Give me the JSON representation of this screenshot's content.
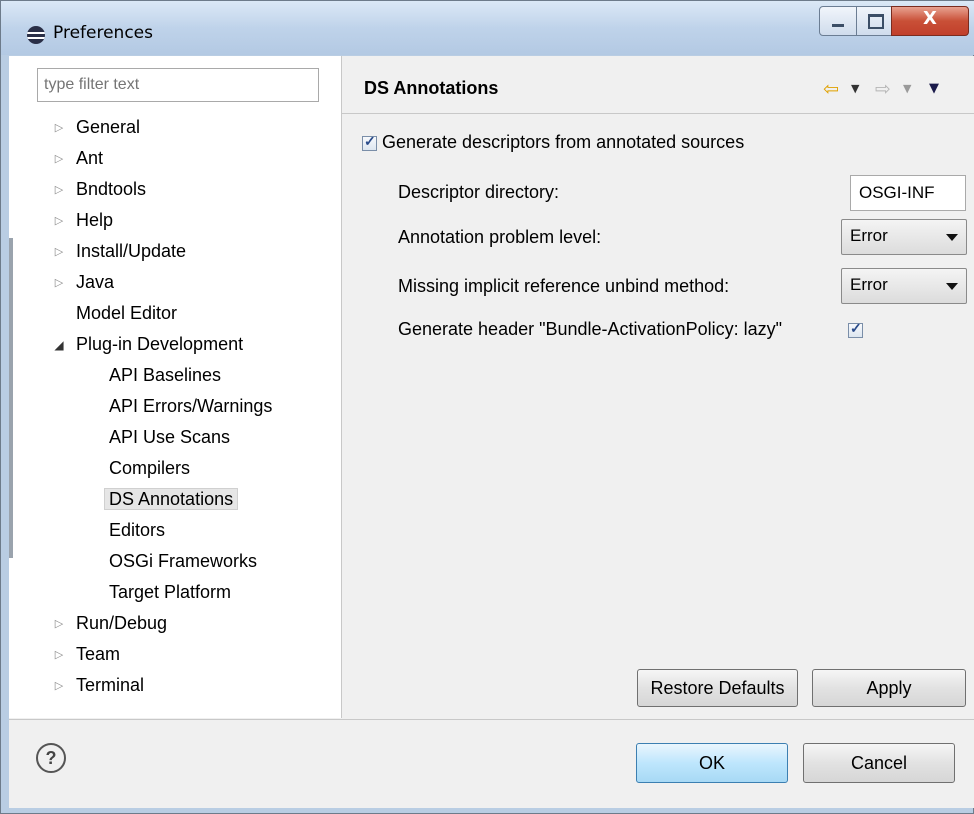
{
  "window": {
    "title": "Preferences",
    "close_glyph": "X"
  },
  "filter": {
    "placeholder": "type filter text"
  },
  "tree": [
    {
      "label": "General",
      "expandable": true,
      "level": 0
    },
    {
      "label": "Ant",
      "expandable": true,
      "level": 0
    },
    {
      "label": "Bndtools",
      "expandable": true,
      "level": 0
    },
    {
      "label": "Help",
      "expandable": true,
      "level": 0
    },
    {
      "label": "Install/Update",
      "expandable": true,
      "level": 0
    },
    {
      "label": "Java",
      "expandable": true,
      "level": 0
    },
    {
      "label": "Model Editor",
      "expandable": false,
      "level": 0
    },
    {
      "label": "Plug-in Development",
      "expandable": true,
      "expanded": true,
      "level": 0
    },
    {
      "label": "API Baselines",
      "level": 1
    },
    {
      "label": "API Errors/Warnings",
      "level": 1
    },
    {
      "label": "API Use Scans",
      "level": 1
    },
    {
      "label": "Compilers",
      "level": 1
    },
    {
      "label": "DS Annotations",
      "level": 1,
      "selected": true
    },
    {
      "label": "Editors",
      "level": 1
    },
    {
      "label": "OSGi Frameworks",
      "level": 1
    },
    {
      "label": "Target Platform",
      "level": 1
    },
    {
      "label": "Run/Debug",
      "expandable": true,
      "level": 0
    },
    {
      "label": "Team",
      "expandable": true,
      "level": 0
    },
    {
      "label": "Terminal",
      "expandable": true,
      "level": 0
    }
  ],
  "page": {
    "title": "DS Annotations",
    "generate_descriptors": {
      "label": "Generate descriptors from annotated sources",
      "checked": true
    },
    "descriptor_directory": {
      "label": "Descriptor directory:",
      "value": "OSGI-INF"
    },
    "annotation_problem_level": {
      "label": "Annotation problem level:",
      "value": "Error"
    },
    "missing_unbind": {
      "label": "Missing implicit reference unbind method:",
      "value": "Error"
    },
    "activation_policy": {
      "label": "Generate header \"Bundle-ActivationPolicy: lazy\"",
      "checked": true
    },
    "restore_defaults": "Restore Defaults",
    "apply": "Apply"
  },
  "footer": {
    "ok": "OK",
    "cancel": "Cancel",
    "help_glyph": "?"
  },
  "icons": {
    "back": "arrow-left-icon",
    "forward": "arrow-right-icon",
    "menu": "chevron-down-icon",
    "help": "help-icon",
    "app": "eclipse-icon"
  },
  "colors": {
    "nav_back": "#e0a100",
    "default_button": "#bee6fd"
  }
}
